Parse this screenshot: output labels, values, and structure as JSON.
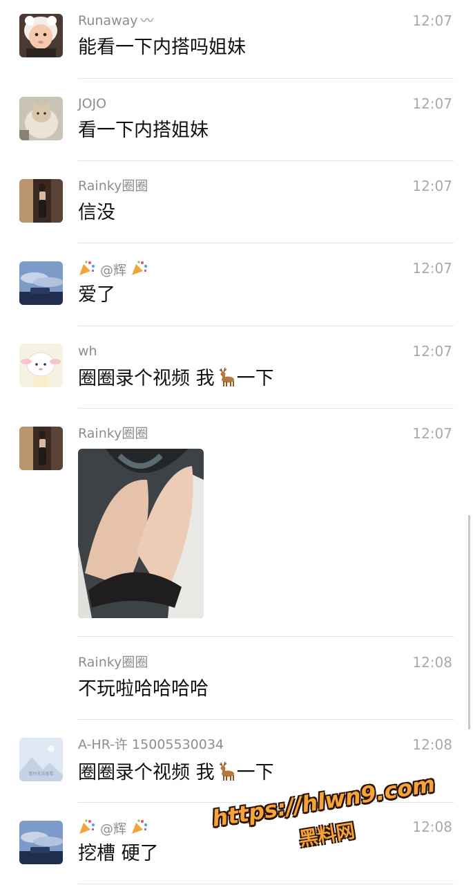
{
  "messages": [
    {
      "name": "Runaway",
      "time": "12:07",
      "text": "能看一下内搭吗姐妹",
      "avatar": "baby-photo"
    },
    {
      "name": "JOJO",
      "time": "12:07",
      "text": "看一下内搭姐妹",
      "avatar": "cat-photo"
    },
    {
      "name": "Rainky圈圈",
      "time": "12:07",
      "text": "信没",
      "avatar": "selfie-photo"
    },
    {
      "name": "@辉",
      "time": "12:07",
      "text": "爱了",
      "avatar": "sky-photo"
    },
    {
      "name": "wh",
      "time": "12:07",
      "text_before": "圈圈录个视频 我",
      "text_after": "一下",
      "avatar": "lamb-illustration"
    },
    {
      "name": "Rainky圈圈",
      "time": "12:07",
      "image": "photo-message",
      "avatar": "selfie-photo"
    },
    {
      "name": "Rainky圈圈",
      "time": "12:08",
      "text": "不玩啦哈哈哈哈"
    },
    {
      "name": "A-HR-许 15005530034",
      "time": "12:08",
      "text_before": "圈圈录个视频 我",
      "text_after": "一下",
      "avatar": "placeholder-image",
      "avatar_caption": "暂时无法查看"
    },
    {
      "name": "@辉",
      "time": "12:08",
      "text": "挖槽 硬了",
      "avatar": "sky-photo"
    }
  ],
  "watermark": {
    "line1": "https://hlwn9.com",
    "line2": "黑料网"
  },
  "colors": {
    "name": "#8d8d8d",
    "time": "#a9a9a9",
    "text": "#111111",
    "divider": "#e4e4e4",
    "watermark": "#f6a33b"
  }
}
